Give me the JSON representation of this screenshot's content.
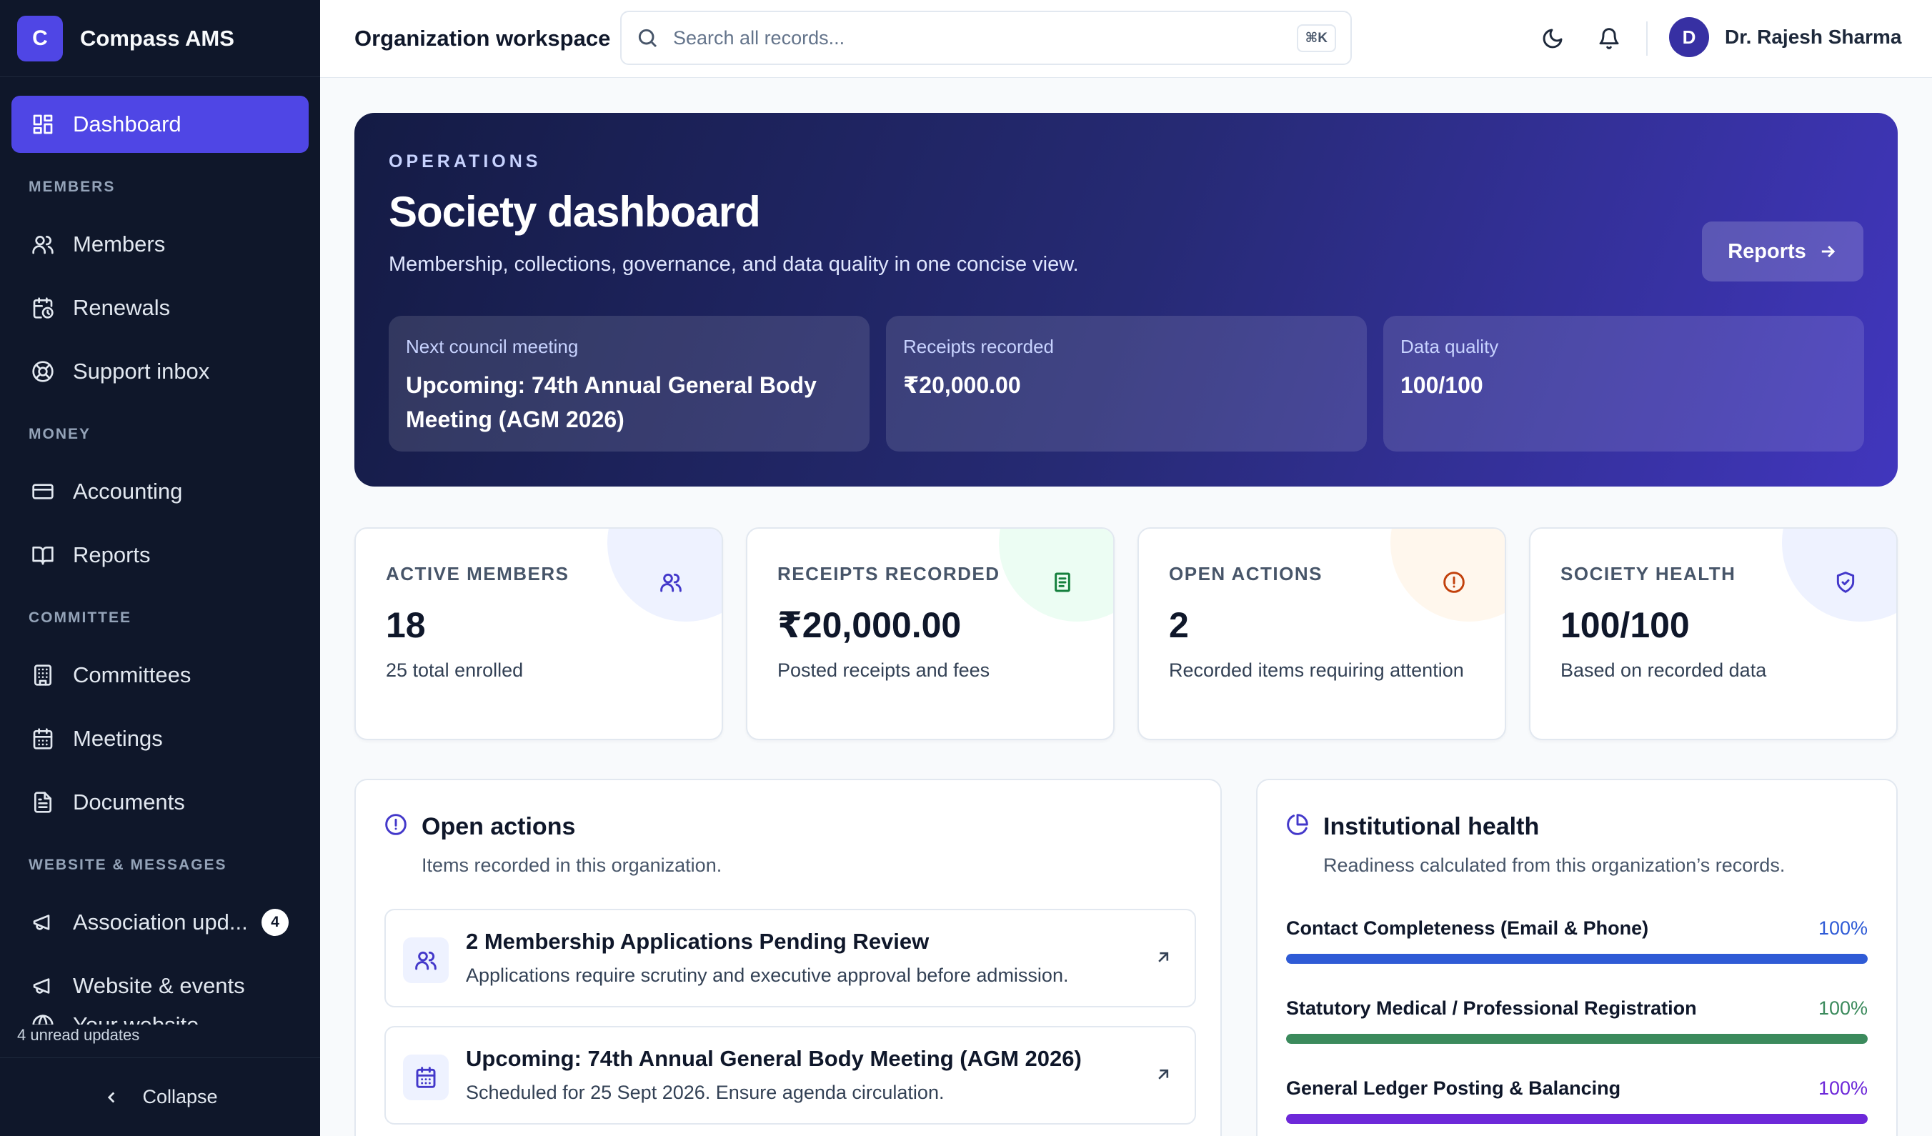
{
  "brand": {
    "initial": "C",
    "name": "Compass AMS"
  },
  "sidebar": {
    "dashboard": "Dashboard",
    "sections": {
      "members": "MEMBERS",
      "money": "MONEY",
      "committee": "COMMITTEE",
      "website": "WEBSITE & MESSAGES"
    },
    "items": {
      "members": "Members",
      "renewals": "Renewals",
      "support": "Support inbox",
      "accounting": "Accounting",
      "reports": "Reports",
      "committees": "Committees",
      "meetings": "Meetings",
      "documents": "Documents",
      "association": "Association upd...",
      "website_events": "Website & events",
      "your_website": "Your website"
    },
    "association_badge": "4",
    "unread_note": "4 unread updates",
    "collapse": "Collapse"
  },
  "topbar": {
    "workspace": "Organization workspace",
    "search_placeholder": "Search all records...",
    "shortcut": "⌘K",
    "user_initial": "D",
    "user_name": "Dr. Rajesh Sharma"
  },
  "hero": {
    "eyebrow": "OPERATIONS",
    "title": "Society dashboard",
    "subtitle": "Membership, collections, governance, and data quality in one concise view.",
    "button": "Reports",
    "cards": [
      {
        "label": "Next council meeting",
        "value": "Upcoming: 74th Annual General Body Meeting (AGM 2026)"
      },
      {
        "label": "Receipts recorded",
        "value": "₹20,000.00"
      },
      {
        "label": "Data quality",
        "value": "100/100"
      }
    ]
  },
  "stats": [
    {
      "label": "ACTIVE MEMBERS",
      "value": "18",
      "sub": "25 total enrolled",
      "icon": "users-icon",
      "color": "#4338ca",
      "tint": "#eef2ff"
    },
    {
      "label": "RECEIPTS RECORDED",
      "value": "₹20,000.00",
      "sub": "Posted receipts and fees",
      "icon": "receipt-icon",
      "color": "#15803d",
      "tint": "#ecfdf3"
    },
    {
      "label": "OPEN ACTIONS",
      "value": "2",
      "sub": "Recorded items requiring attention",
      "icon": "alert-circle-icon",
      "color": "#c2410c",
      "tint": "#fff7ed"
    },
    {
      "label": "SOCIETY HEALTH",
      "value": "100/100",
      "sub": "Based on recorded data",
      "icon": "shield-check-icon",
      "color": "#4338ca",
      "tint": "#eef2ff"
    }
  ],
  "open_actions": {
    "title": "Open actions",
    "subtitle": "Items recorded in this organization.",
    "items": [
      {
        "title": "2 Membership Applications Pending Review",
        "desc": "Applications require scrutiny and executive approval before admission."
      },
      {
        "title": "Upcoming: 74th Annual General Body Meeting (AGM 2026)",
        "desc": "Scheduled for 25 Sept 2026. Ensure agenda circulation."
      }
    ]
  },
  "health": {
    "title": "Institutional health",
    "subtitle": "Readiness calculated from this organization’s records.",
    "metrics": [
      {
        "name": "Contact Completeness (Email & Phone)",
        "pct": "100%",
        "level": 1.0,
        "color": "#2f5bd6"
      },
      {
        "name": "Statutory Medical / Professional Registration",
        "pct": "100%",
        "level": 1.0,
        "color": "#3b8a5c"
      },
      {
        "name": "General Ledger Posting & Balancing",
        "pct": "100%",
        "level": 1.0,
        "color": "#6d28d9"
      }
    ]
  }
}
